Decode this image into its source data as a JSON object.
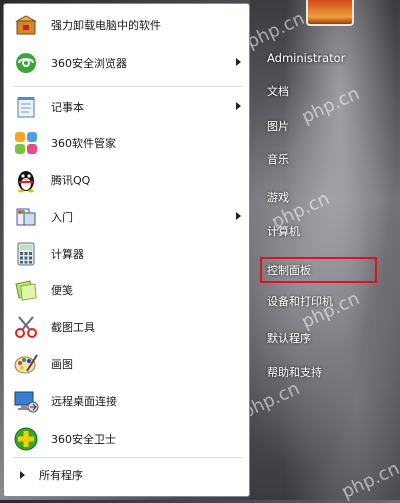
{
  "pinned_items": [
    {
      "label": "强力卸载电脑中的软件",
      "icon": "uninstaller-box-icon",
      "has_arrow": false
    },
    {
      "label": "360安全浏览器",
      "icon": "360-browser-icon",
      "has_arrow": true
    },
    {
      "label": "记事本",
      "icon": "notepad-icon",
      "has_arrow": true
    },
    {
      "label": "360软件管家",
      "icon": "360-software-manager-icon",
      "has_arrow": false
    },
    {
      "label": "腾讯QQ",
      "icon": "qq-penguin-icon",
      "has_arrow": false
    },
    {
      "label": "入门",
      "icon": "getting-started-icon",
      "has_arrow": true
    },
    {
      "label": "计算器",
      "icon": "calculator-icon",
      "has_arrow": false
    },
    {
      "label": "便笺",
      "icon": "sticky-notes-icon",
      "has_arrow": false
    },
    {
      "label": "截图工具",
      "icon": "snipping-tool-icon",
      "has_arrow": false
    },
    {
      "label": "画图",
      "icon": "paint-icon",
      "has_arrow": false
    },
    {
      "label": "远程桌面连接",
      "icon": "remote-desktop-icon",
      "has_arrow": false
    },
    {
      "label": "360安全卫士",
      "icon": "360-safeguard-icon",
      "has_arrow": false
    }
  ],
  "all_programs_label": "所有程序",
  "right_items": [
    {
      "label": "Administrator",
      "name": "user-name"
    },
    {
      "label": "文档",
      "name": "documents"
    },
    {
      "label": "图片",
      "name": "pictures"
    },
    {
      "label": "音乐",
      "name": "music"
    },
    {
      "label": "游戏",
      "name": "games"
    },
    {
      "label": "计算机",
      "name": "computer"
    },
    {
      "label": "控制面板",
      "name": "control-panel"
    },
    {
      "label": "设备和打印机",
      "name": "devices-and-printers"
    },
    {
      "label": "默认程序",
      "name": "default-programs"
    },
    {
      "label": "帮助和支持",
      "name": "help-and-support"
    }
  ],
  "watermark": "php.cn",
  "colors": {
    "highlight": "#d9161a",
    "panel_bg": "#ffffff"
  }
}
